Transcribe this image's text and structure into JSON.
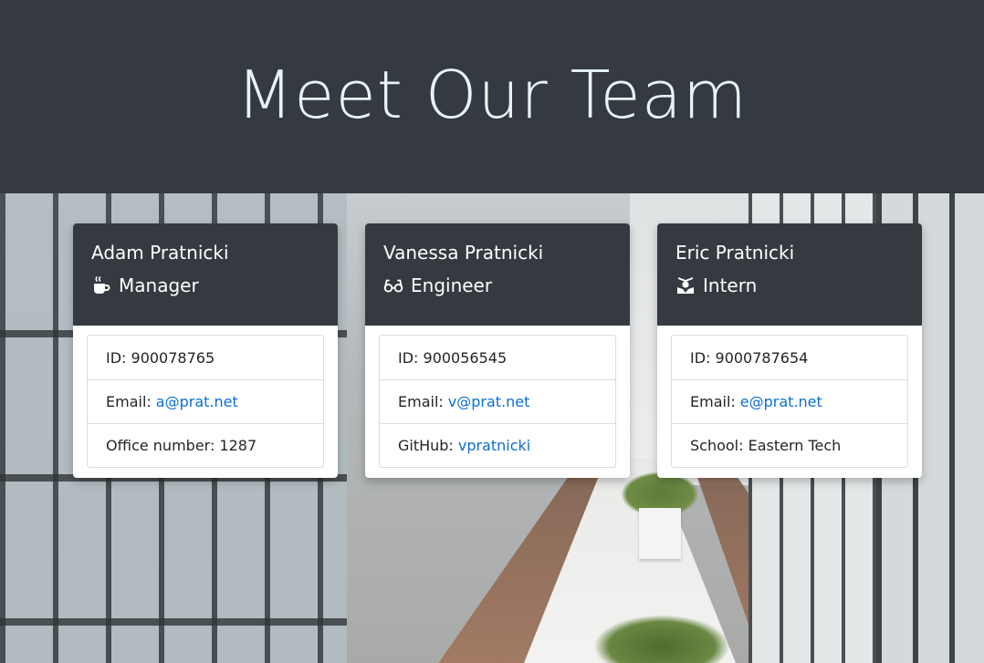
{
  "header": {
    "title": "Meet Our Team"
  },
  "colors": {
    "header_bg": "#343a40",
    "title_text": "#e6f3f7",
    "link": "#0b6fd6"
  },
  "employees": [
    {
      "name": "Adam Pratnicki",
      "role": "Manager",
      "role_icon": "mug-icon",
      "id_text": "ID: 900078765",
      "email_label": "Email:",
      "email": "a@prat.net",
      "extra_label": "Office number: 1287",
      "extra_link": ""
    },
    {
      "name": "Vanessa Pratnicki",
      "role": "Engineer",
      "role_icon": "glasses-icon",
      "id_text": "ID: 900056545",
      "email_label": "Email:",
      "email": "v@prat.net",
      "extra_label": "GitHub:",
      "extra_link": "vpratnicki"
    },
    {
      "name": "Eric Pratnicki",
      "role": "Intern",
      "role_icon": "graduate-icon",
      "id_text": "ID: 9000787654",
      "email_label": "Email:",
      "email": "e@prat.net",
      "extra_label": "School: Eastern Tech",
      "extra_link": ""
    }
  ]
}
